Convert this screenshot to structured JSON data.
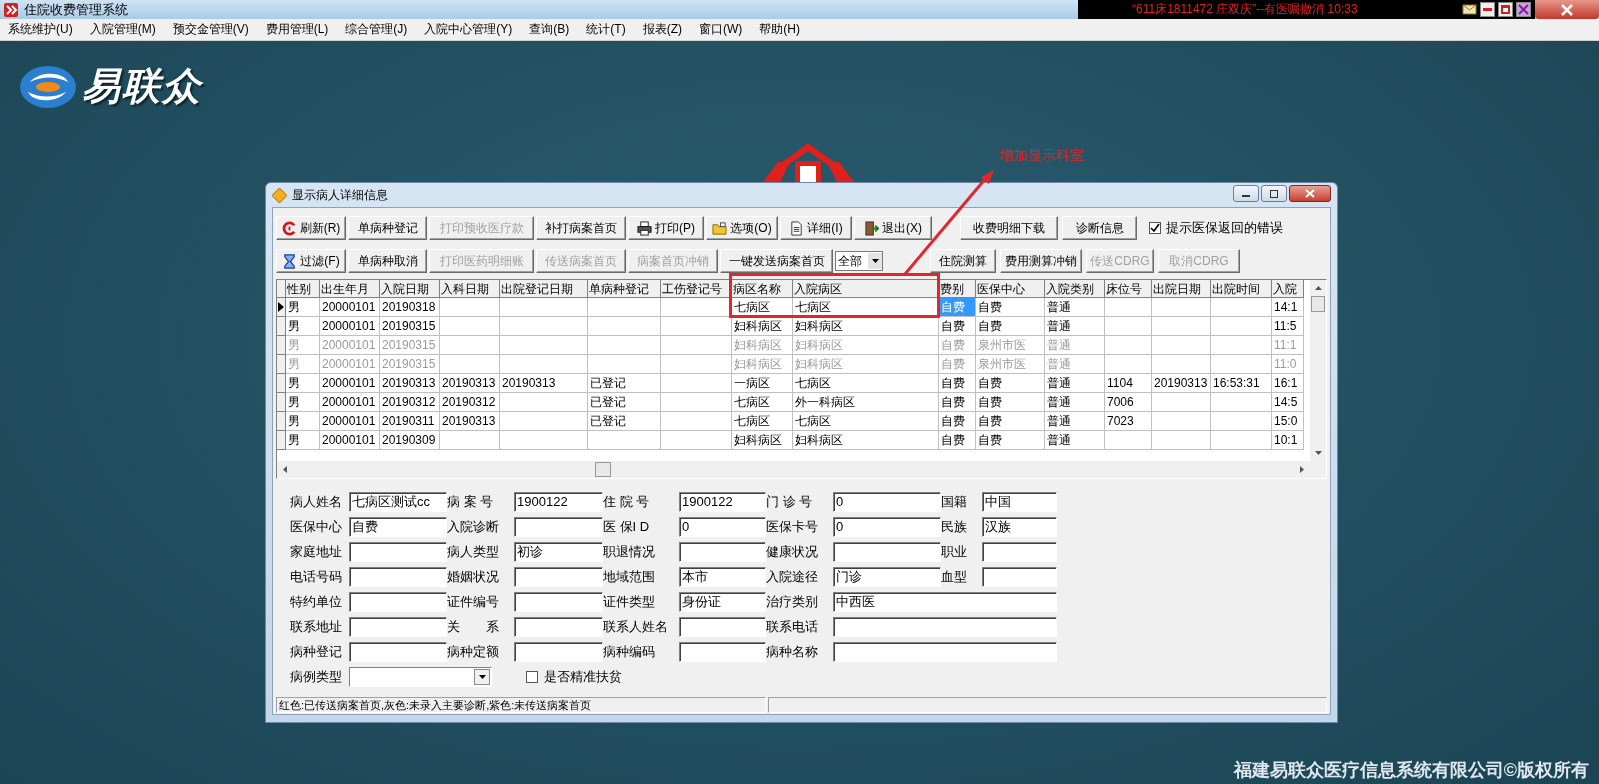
{
  "title_bar": {
    "title": "住院收费管理系统",
    "notice": "“611床1811472 庄双庆”--有医嘱撤消 10:33"
  },
  "menu": [
    "系统维护(U)",
    "入院管理(M)",
    "预交金管理(V)",
    "费用管理(L)",
    "综合管理(J)",
    "入院中心管理(Y)",
    "查询(B)",
    "统计(T)",
    "报表(Z)",
    "窗口(W)",
    "帮助(H)"
  ],
  "desktop": {
    "logo_text": "易联众",
    "copyright": "福建易联众医疗信息系统有限公司©版权所有"
  },
  "annotation": {
    "text": "增加显示科室"
  },
  "dialog": {
    "title": "显示病人详细信息",
    "toolbar": [
      [
        {
          "kind": "refresh",
          "label": "刷新(R)",
          "disabled": false
        },
        {
          "kind": "plain",
          "label": "单病种登记",
          "disabled": false
        },
        {
          "kind": "plain",
          "label": "打印预收医疗款",
          "disabled": true
        },
        {
          "kind": "plain",
          "label": "补打病案首页",
          "disabled": false
        },
        {
          "kind": "print",
          "label": "打印(P)",
          "disabled": false
        },
        {
          "kind": "options",
          "label": "选项(O)",
          "disabled": false
        },
        {
          "kind": "detail",
          "label": "详细(I)",
          "disabled": false
        },
        {
          "kind": "exit",
          "label": "退出(X)",
          "disabled": false
        },
        {
          "kind": "plain",
          "label": "收费明细下载",
          "disabled": false
        },
        {
          "kind": "plain",
          "label": "诊断信息",
          "disabled": false
        },
        {
          "kind": "checkbox",
          "label": "提示医保返回的错误",
          "checked": true
        }
      ],
      [
        {
          "kind": "filter",
          "label": "过滤(F)",
          "disabled": false
        },
        {
          "kind": "plain",
          "label": "单病种取消",
          "disabled": false
        },
        {
          "kind": "plain",
          "label": "打印医药明细账",
          "disabled": true
        },
        {
          "kind": "plain",
          "label": "传送病案首页",
          "disabled": true
        },
        {
          "kind": "plain",
          "label": "病案首页冲销",
          "disabled": true
        },
        {
          "kind": "plain",
          "label": "一键发送病案首页",
          "disabled": false
        },
        {
          "kind": "dropdown",
          "value": "全部"
        },
        {
          "kind": "plain",
          "label": "住院测算",
          "disabled": false
        },
        {
          "kind": "plain",
          "label": "费用测算冲销",
          "disabled": false
        },
        {
          "kind": "plain",
          "label": "传送CDRG",
          "disabled": true
        },
        {
          "kind": "plain",
          "label": "取消CDRG",
          "disabled": true
        }
      ]
    ],
    "table": {
      "columns": [
        "性别",
        "出生年月",
        "入院日期",
        "入科日期",
        "出院登记日期",
        "单病种登记",
        "工伤登记号",
        "病区名称",
        "入院病区",
        "费别",
        "医保中心",
        "入院类别",
        "床位号",
        "出院日期",
        "出院时间",
        "入院"
      ],
      "rows": [
        {
          "selected": true,
          "greyed": false,
          "cells": [
            "男",
            "20000101",
            "20190318",
            null,
            null,
            null,
            null,
            "七病区",
            "七病区",
            {
              "text": "自费",
              "selected": true
            },
            "自费",
            "普通",
            null,
            null,
            null,
            "14:1"
          ]
        },
        {
          "selected": false,
          "greyed": false,
          "cells": [
            "男",
            "20000101",
            "20190315",
            null,
            null,
            null,
            null,
            "妇科病区",
            "妇科病区",
            "自费",
            "自费",
            "普通",
            null,
            null,
            null,
            "11:5"
          ]
        },
        {
          "selected": false,
          "greyed": true,
          "cells": [
            "男",
            "20000101",
            "20190315",
            null,
            null,
            null,
            null,
            "妇科病区",
            "妇科病区",
            "自费",
            "泉州市医",
            "普通",
            null,
            null,
            null,
            "11:1"
          ]
        },
        {
          "selected": false,
          "greyed": true,
          "cells": [
            "男",
            "20000101",
            "20190315",
            null,
            null,
            null,
            null,
            "妇科病区",
            "妇科病区",
            "自费",
            "泉州市医",
            "普通",
            null,
            null,
            null,
            "11:0"
          ]
        },
        {
          "selected": false,
          "greyed": false,
          "cells": [
            "男",
            "20000101",
            "20190313",
            "20190313",
            "20190313",
            "已登记",
            null,
            "一病区",
            "七病区",
            "自费",
            "自费",
            "普通",
            "1104",
            "20190313",
            "16:53:31",
            "16:1"
          ]
        },
        {
          "selected": false,
          "greyed": false,
          "cells": [
            "男",
            "20000101",
            "20190312",
            "20190312",
            null,
            "已登记",
            null,
            "七病区",
            "外一科病区",
            "自费",
            "自费",
            "普通",
            "7006",
            null,
            null,
            "14:5"
          ]
        },
        {
          "selected": false,
          "greyed": false,
          "cells": [
            "男",
            "20000101",
            "20190311",
            "20190313",
            null,
            "已登记",
            null,
            "七病区",
            "七病区",
            "自费",
            "自费",
            "普通",
            "7023",
            null,
            null,
            "15:0"
          ]
        },
        {
          "selected": false,
          "greyed": false,
          "cells": [
            "男",
            "20000101",
            "20190309",
            null,
            null,
            null,
            null,
            "妇科病区",
            "妇科病区",
            "自费",
            "自费",
            "普通",
            null,
            null,
            null,
            "10:1"
          ]
        }
      ]
    },
    "form": {
      "rows": [
        [
          {
            "label": "病人姓名",
            "value": "七病区测试cc"
          },
          {
            "label": "病 案 号",
            "value": "1900122"
          },
          {
            "label": "住 院 号",
            "value": "1900122"
          },
          {
            "label": "门 诊 号",
            "value": "0"
          },
          {
            "label": "国籍",
            "value": "中国"
          }
        ],
        [
          {
            "label": "医保中心",
            "value": "自费"
          },
          {
            "label": "入院诊断"
          },
          {
            "label": "医 保I D",
            "value": "0"
          },
          {
            "label": "医保卡号",
            "value": "0"
          },
          {
            "label": "民族",
            "value": "汉族"
          }
        ],
        [
          {
            "label": "家庭地址"
          },
          {
            "label": "病人类型",
            "value": "初诊"
          },
          {
            "label": "职退情况"
          },
          {
            "label": "健康状况"
          },
          {
            "label": "职业"
          }
        ],
        [
          {
            "label": "电话号码"
          },
          {
            "label": "婚姻状况"
          },
          {
            "label": "地域范围",
            "value": "本市"
          },
          {
            "label": "入院途径",
            "value": "门诊"
          },
          {
            "label": "血型"
          }
        ],
        [
          {
            "label": "特约单位"
          },
          {
            "label": "证件编号"
          },
          {
            "label": "证件类型",
            "value": "身份证"
          },
          {
            "label": "治疗类别",
            "value": "中西医"
          }
        ],
        [
          {
            "label": "联系地址"
          },
          {
            "label": "关　　系"
          },
          {
            "label": "联系人姓名"
          },
          {
            "label": "联系电话"
          }
        ],
        [
          {
            "label": "病种登记"
          },
          {
            "label": "病种定额"
          },
          {
            "label": "病种编码"
          },
          {
            "label": "病种名称"
          }
        ]
      ],
      "case_type": {
        "label": "病例类型"
      },
      "poverty": {
        "label": "是否精准扶贫",
        "checked": false
      }
    },
    "status_bar": [
      "红色:已传送病案首页,灰色:未录入主要诊断,紫色:未传送病案首页"
    ]
  }
}
